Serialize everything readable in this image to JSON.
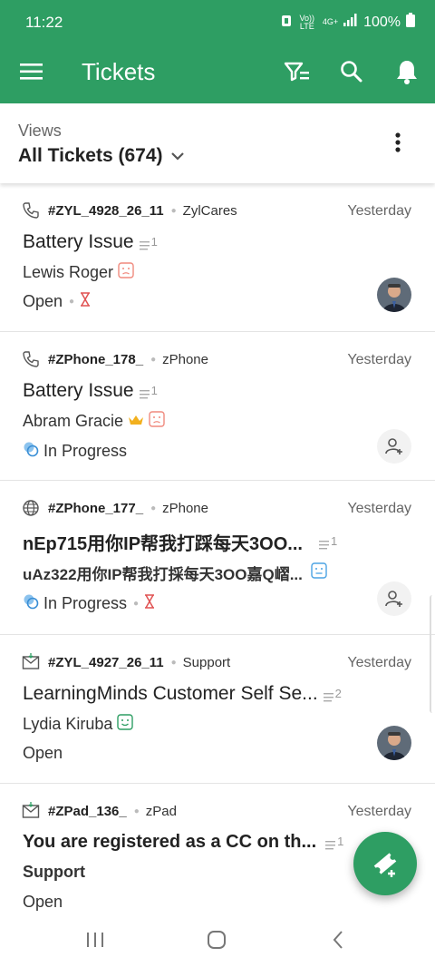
{
  "status_bar": {
    "time": "11:22",
    "battery": "100%",
    "network": "4G+",
    "volte": "Vo)) LTE"
  },
  "app_bar": {
    "title": "Tickets",
    "accent": "#2e9e63"
  },
  "views": {
    "label": "Views",
    "selected": "All Tickets (674)"
  },
  "tickets": [
    {
      "channel": "phone-icon",
      "id": "#ZYL_4928_26_11",
      "department": "ZylCares",
      "date": "Yesterday",
      "subject": "Battery Issue",
      "thread_count": "1",
      "contact": "Lewis Roger",
      "sentiment": "unhappy",
      "status": "Open",
      "overdue": true,
      "assignee": "avatar"
    },
    {
      "channel": "phone-icon",
      "id": "#ZPhone_178_",
      "department": "zPhone",
      "date": "Yesterday",
      "subject": "Battery Issue",
      "thread_count": "1",
      "contact": "Abram Gracie",
      "vip": true,
      "sentiment": "unhappy",
      "status": "In Progress",
      "assignee": "unassigned"
    },
    {
      "channel": "globe-icon",
      "id": "#ZPhone_177_",
      "department": "zPhone",
      "date": "Yesterday",
      "subject": "nEp715用你IP帮我打踩每天3OO...",
      "thread_count": "1",
      "contact": "uAz322用你IP帮我打採每天3OO嘉Q嶍...",
      "sentiment": "neutral",
      "status": "In Progress",
      "overdue": true,
      "assignee": "unassigned"
    },
    {
      "channel": "mail-icon",
      "id": "#ZYL_4927_26_11",
      "department": "Support",
      "date": "Yesterday",
      "subject": "LearningMinds Customer Self Se...",
      "thread_count": "2",
      "contact": "Lydia Kiruba",
      "sentiment": "happy",
      "status": "Open",
      "assignee": "avatar"
    },
    {
      "channel": "mail-in-icon",
      "id": "#ZPad_136_",
      "department": "zPad",
      "date": "Yesterday",
      "subject": "You are registered as a CC on th...",
      "thread_count": "1",
      "contact": "Support",
      "status": "Open",
      "assignee": "unassigned"
    }
  ]
}
